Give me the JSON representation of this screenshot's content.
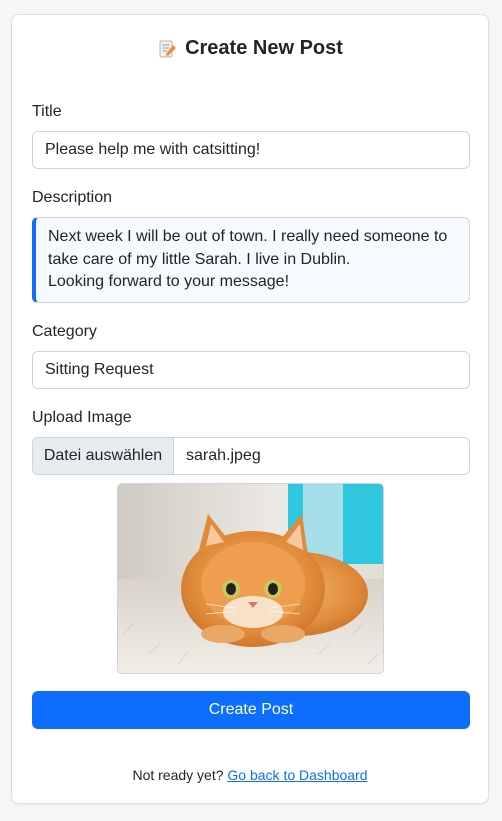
{
  "header": {
    "title": "Create New Post",
    "icon": "memo-icon"
  },
  "form": {
    "title_label": "Title",
    "title_value": "Please help me with catsitting!",
    "description_label": "Description",
    "description_value": "Next week I will be out of town. I really need someone to take care of my little Sarah. I live in Dublin.\nLooking forward to your message!",
    "category_label": "Category",
    "category_value": "Sitting Request",
    "upload_label": "Upload Image",
    "file_button_label": "Datei auswählen",
    "file_name": "sarah.jpeg",
    "submit_label": "Create Post"
  },
  "footer": {
    "prompt": "Not ready yet?",
    "link_label": "Go back to Dashboard"
  },
  "colors": {
    "primary": "#0d6efd",
    "page_background": "#f5f6f8",
    "card_background": "#ffffff"
  }
}
